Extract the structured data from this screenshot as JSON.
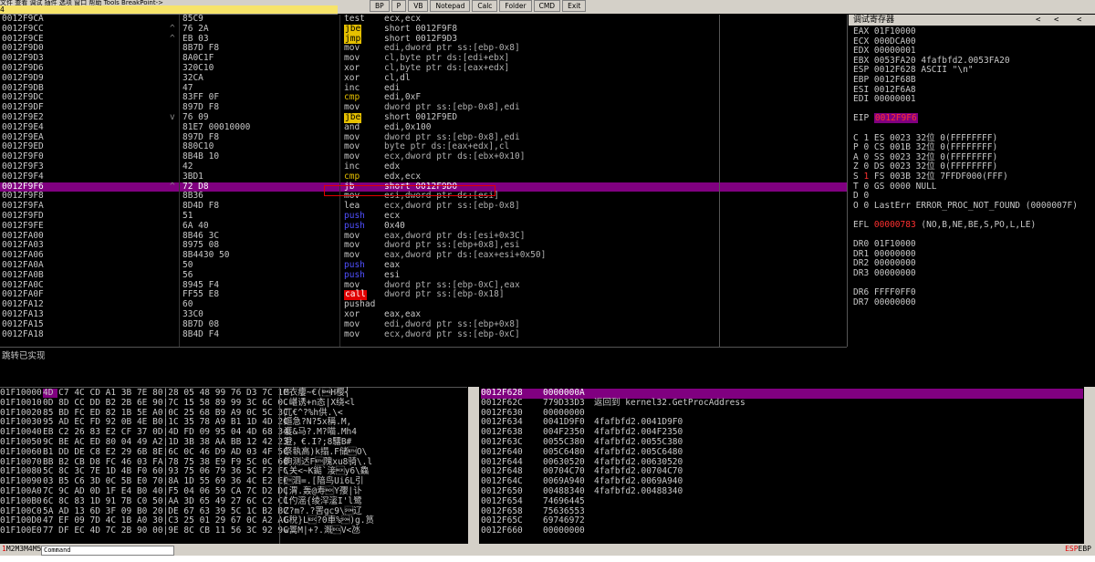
{
  "topbar": {
    "menu_text": "文件 查看 调试 插件 选项 窗口 帮助  Tools  BreakPoint->",
    "addr_field": "4",
    "buttons": [
      "BP",
      "P",
      "VB",
      "Notepad",
      "Calc",
      "Folder",
      "CMD",
      "Exit"
    ]
  },
  "disasm": {
    "rows": [
      {
        "addr": "0012F9CA",
        "mark": "",
        "hex": "85C9",
        "mn": "test",
        "op": "ecx,ecx",
        "mnStyle": "",
        "opStyle": "",
        "sel": false
      },
      {
        "addr": "0012F9CC",
        "mark": "^",
        "hex": "76 2A",
        "mn": "jbe",
        "op": "short 0012F9F8",
        "mnStyle": "jmp",
        "opStyle": "",
        "sel": false
      },
      {
        "addr": "0012F9CE",
        "mark": "^",
        "hex": "EB 03",
        "mn": "jmp",
        "op": "short 0012F9D3",
        "mnStyle": "jmp",
        "opStyle": "",
        "sel": false
      },
      {
        "addr": "0012F9D0",
        "mark": "",
        "hex": "8B7D F8",
        "mn": "mov",
        "op": "edi,dword ptr ss:[ebp-0x8]",
        "mnStyle": "",
        "opStyle": "mem",
        "sel": false
      },
      {
        "addr": "0012F9D3",
        "mark": "",
        "hex": "8A0C1F",
        "mn": "mov",
        "op": "cl,byte ptr ds:[edi+ebx]",
        "mnStyle": "",
        "opStyle": "mem",
        "sel": false
      },
      {
        "addr": "0012F9D6",
        "mark": "",
        "hex": "320C10",
        "mn": "xor",
        "op": "cl,byte ptr ds:[eax+edx]",
        "mnStyle": "",
        "opStyle": "mem",
        "sel": false
      },
      {
        "addr": "0012F9D9",
        "mark": "",
        "hex": "32CA",
        "mn": "xor",
        "op": "cl,dl",
        "mnStyle": "",
        "opStyle": "",
        "sel": false
      },
      {
        "addr": "0012F9DB",
        "mark": "",
        "hex": "47",
        "mn": "inc",
        "op": "edi",
        "mnStyle": "",
        "opStyle": "",
        "sel": false
      },
      {
        "addr": "0012F9DC",
        "mark": "",
        "hex": "83FF 0F",
        "mn": "cmp",
        "op": "edi,0xF",
        "mnStyle": "cmp",
        "opStyle": "",
        "sel": false
      },
      {
        "addr": "0012F9DF",
        "mark": "",
        "hex": "897D F8",
        "mn": "mov",
        "op": "dword ptr ss:[ebp-0x8],edi",
        "mnStyle": "",
        "opStyle": "mem",
        "sel": false
      },
      {
        "addr": "0012F9E2",
        "mark": "v",
        "hex": "76 09",
        "mn": "jbe",
        "op": "short 0012F9ED",
        "mnStyle": "jmp",
        "opStyle": "",
        "sel": false
      },
      {
        "addr": "0012F9E4",
        "mark": "",
        "hex": "81E7 00010000",
        "mn": "and",
        "op": "edi,0x100",
        "mnStyle": "",
        "opStyle": "",
        "sel": false
      },
      {
        "addr": "0012F9EA",
        "mark": "",
        "hex": "897D F8",
        "mn": "mov",
        "op": "dword ptr ss:[ebp-0x8],edi",
        "mnStyle": "",
        "opStyle": "mem",
        "sel": false
      },
      {
        "addr": "0012F9ED",
        "mark": "",
        "hex": "880C10",
        "mn": "mov",
        "op": "byte ptr ds:[eax+edx],cl",
        "mnStyle": "",
        "opStyle": "mem",
        "sel": false
      },
      {
        "addr": "0012F9F0",
        "mark": "",
        "hex": "8B4B 10",
        "mn": "mov",
        "op": "ecx,dword ptr ds:[ebx+0x10]",
        "mnStyle": "",
        "opStyle": "mem",
        "sel": false
      },
      {
        "addr": "0012F9F3",
        "mark": "",
        "hex": "42",
        "mn": "inc",
        "op": "edx",
        "mnStyle": "",
        "opStyle": "",
        "sel": false
      },
      {
        "addr": "0012F9F4",
        "mark": "",
        "hex": "3BD1",
        "mn": "cmp",
        "op": "edx,ecx",
        "mnStyle": "cmp",
        "opStyle": "",
        "sel": false
      },
      {
        "addr": "0012F9F6",
        "mark": "^",
        "hex": "72 D8",
        "mn": "jb",
        "op": "short 0012F9D0",
        "mnStyle": "jmp",
        "opStyle": "",
        "sel": true
      },
      {
        "addr": "0012F9F8",
        "mark": "",
        "hex": "8B36",
        "mn": "mov",
        "op": "esi,dword ptr ds:[esi]",
        "mnStyle": "",
        "opStyle": "mem",
        "sel": false
      },
      {
        "addr": "0012F9FA",
        "mark": "",
        "hex": "8D4D F8",
        "mn": "lea",
        "op": "ecx,dword ptr ss:[ebp-0x8]",
        "mnStyle": "",
        "opStyle": "mem",
        "sel": false
      },
      {
        "addr": "0012F9FD",
        "mark": "",
        "hex": "51",
        "mn": "push",
        "op": "ecx",
        "mnStyle": "push",
        "opStyle": "",
        "sel": false
      },
      {
        "addr": "0012F9FE",
        "mark": "",
        "hex": "6A 40",
        "mn": "push",
        "op": "0x40",
        "mnStyle": "push",
        "opStyle": "imm",
        "sel": false
      },
      {
        "addr": "0012FA00",
        "mark": "",
        "hex": "8B46 3C",
        "mn": "mov",
        "op": "eax,dword ptr ds:[esi+0x3C]",
        "mnStyle": "",
        "opStyle": "mem",
        "sel": false
      },
      {
        "addr": "0012FA03",
        "mark": "",
        "hex": "8975 08",
        "mn": "mov",
        "op": "dword ptr ss:[ebp+0x8],esi",
        "mnStyle": "",
        "opStyle": "mem",
        "sel": false
      },
      {
        "addr": "0012FA06",
        "mark": "",
        "hex": "8B4430 50",
        "mn": "mov",
        "op": "eax,dword ptr ds:[eax+esi+0x50]",
        "mnStyle": "",
        "opStyle": "mem",
        "sel": false
      },
      {
        "addr": "0012FA0A",
        "mark": "",
        "hex": "50",
        "mn": "push",
        "op": "eax",
        "mnStyle": "push",
        "opStyle": "",
        "sel": false
      },
      {
        "addr": "0012FA0B",
        "mark": "",
        "hex": "56",
        "mn": "push",
        "op": "esi",
        "mnStyle": "push",
        "opStyle": "",
        "sel": false
      },
      {
        "addr": "0012FA0C",
        "mark": "",
        "hex": "8945 F4",
        "mn": "mov",
        "op": "dword ptr ss:[ebp-0xC],eax",
        "mnStyle": "",
        "opStyle": "mem",
        "sel": false
      },
      {
        "addr": "0012FA0F",
        "mark": "",
        "hex": "FF55 E8",
        "mn": "call",
        "op": "dword ptr ss:[ebp-0x18]",
        "mnStyle": "call",
        "opStyle": "mem",
        "sel": false
      },
      {
        "addr": "0012FA12",
        "mark": "",
        "hex": "60",
        "mn": "pushad",
        "op": "",
        "mnStyle": "",
        "opStyle": "",
        "sel": false
      },
      {
        "addr": "0012FA13",
        "mark": "",
        "hex": "33C0",
        "mn": "xor",
        "op": "eax,eax",
        "mnStyle": "",
        "opStyle": "",
        "sel": false
      },
      {
        "addr": "0012FA15",
        "mark": "",
        "hex": "8B7D 08",
        "mn": "mov",
        "op": "edi,dword ptr ss:[ebp+0x8]",
        "mnStyle": "",
        "opStyle": "mem",
        "sel": false
      },
      {
        "addr": "0012FA18",
        "mark": "",
        "hex": "8B4D F4",
        "mn": "mov",
        "op": "ecx,dword ptr ss:[ebp-0xC]",
        "mnStyle": "",
        "opStyle": "mem",
        "sel": false
      }
    ]
  },
  "info": {
    "text": "跳转已实现"
  },
  "registers": {
    "title": "调试寄存器",
    "lines": [
      {
        "t": "EAX 01F10000",
        "s": ""
      },
      {
        "t": "ECX 000DCA00",
        "s": ""
      },
      {
        "t": "EDX 00000001",
        "s": ""
      },
      {
        "t": "EBX 0053FA20  4fafbfd2.0053FA20",
        "s": ""
      },
      {
        "t": "ESP 0012F628  ASCII \"\\n\"",
        "s": ""
      },
      {
        "t": "EBP 0012F68B",
        "s": ""
      },
      {
        "t": "ESI 0012F6A8",
        "s": ""
      },
      {
        "t": "EDI 00000001",
        "s": ""
      },
      {
        "t": "",
        "s": ""
      },
      {
        "t": "EIP",
        "s": "",
        "hl": "0012F9F6"
      },
      {
        "t": "",
        "s": ""
      },
      {
        "t": "C 1  ES 0023 32位 0(FFFFFFFF)",
        "s": ""
      },
      {
        "t": "P 0  CS 001B 32位 0(FFFFFFFF)",
        "s": ""
      },
      {
        "t": "A 0  SS 0023 32位 0(FFFFFFFF)",
        "s": ""
      },
      {
        "t": "Z 0  DS 0023 32位 0(FFFFFFFF)",
        "s": ""
      },
      {
        "t": "S 1  FS 003B 32位 7FFDF000(FFF)",
        "s": "sflag"
      },
      {
        "t": "T 0  GS 0000 NULL",
        "s": ""
      },
      {
        "t": "D 0",
        "s": ""
      },
      {
        "t": "O 0  LastErr ERROR_PROC_NOT_FOUND (0000007F)",
        "s": ""
      },
      {
        "t": "",
        "s": ""
      },
      {
        "t": "EFL",
        "s": "efl",
        "red": "00000783",
        "rest": " (NO,B,NE,BE,S,PO,L,LE)"
      },
      {
        "t": "",
        "s": ""
      },
      {
        "t": "DR0 01F10000",
        "s": ""
      },
      {
        "t": "DR1 00000000",
        "s": ""
      },
      {
        "t": "DR2 00000000",
        "s": ""
      },
      {
        "t": "DR3 00000000",
        "s": ""
      },
      {
        "t": "",
        "s": ""
      },
      {
        "t": "DR6 FFFF0FF0",
        "s": ""
      },
      {
        "t": "DR7 00000000",
        "s": ""
      }
    ]
  },
  "dump": {
    "rows": [
      {
        "a": "01F10000",
        "h": "4D C7 4C CD A1 3B 7E 80|28 05 48 99 76 D3 7C 1C",
        "s": "M衣瘻~€(\u0005H樱⎨"
      },
      {
        "a": "01F10010",
        "h": "0D 8D CC DD B2 2B 6E 90|7C 15 58 89 99 3C 6C 0C",
        "s": ".嵁诱+n态|X绕<l"
      },
      {
        "a": "01F10020",
        "h": "85 BD FC ED 82 1B 5E A0|0C 25 68 B9 A9 0C 5C 3C",
        "s": "兀€^?%h供.\\<"
      },
      {
        "a": "01F10030",
        "h": "95 AD EC FD 92 0B 4E B0|1C 35 78 A9 B1 1D 4D 2C",
        "s": "嫗急?N?5x稱.M,"
      },
      {
        "a": "01F10040",
        "h": "EB C2 26 83 E2 CF 37 0D|4D FD 09 95 04 4D 68 34",
        "s": "濩&马?.M?喵.Mh4"
      },
      {
        "a": "01F10050",
        "h": "9C BE AC ED 80 04 49 A2|1D 3B 38 AA BB 12 42 23",
        "s": "澄，€.I?;8驑B#"
      },
      {
        "a": "01F10060",
        "h": "B1 DD DE C8 E2 29 6B 8E|6C 0C 46 D9 AD 03 4F 5C",
        "s": "祭執高)k搨.F储\u0003O\\"
      },
      {
        "a": "01F10070",
        "h": "BB B2 CB D8 FC 46 03 FA|78 75 38 E9 F9 5C 0C 6C",
        "s": "齁测迖F\u0003隗xu8骑\\.l"
      },
      {
        "a": "01F10080",
        "h": "5C 8C 3C 7E 1D 4B F0 60|93 75 06 79 36 5C F2 FC",
        "s": "\\关<~K鐑`淁\u0006y6\\鱻"
      },
      {
        "a": "01F10090",
        "h": "03 B5 C6 3D 0C 5B E0 70|8A 1D 55 69 36 4C E2 EC",
        "s": "\u0003泗=.[隌鸟Ui6L引"
      },
      {
        "a": "01F100A0",
        "h": "7C 9C AD 0D 1F E4 B0 40|F5 04 06 59 CA 7C D2 DC",
        "s": "|渭.轰@寿\u0006Y孾|讣"
      },
      {
        "a": "01F100B0",
        "h": "6C 8C 83 1D 91 7B C0 50|AA 3D 65 49 27 6C C2 CC",
        "s": "l仢滛{绫浫㵥I'l鹭"
      },
      {
        "a": "01F100C0",
        "h": "5A AD 13 6D 3F 09 B0 20|DE 67 63 39 5C 1C B2 BC",
        "s": "Z?m?.?罟gc9\\\u0001辽"
      },
      {
        "a": "01F100D0",
        "h": "47 EF 09 7D 4C 1B A0 30|C3 25 01 29 67 0C A2 AC",
        "s": "G稅}L\u001b?0車%\u0001)g.筼"
      },
      {
        "a": "01F100E0",
        "h": "77 DF EC 4D 7C 2B 90 00|9E 8C CB 11 56 3C 92 9C",
        "s": "w暠M|+?.溉\u0011V<氹"
      }
    ]
  },
  "stack": {
    "rows": [
      {
        "a": "0012F628",
        "v": "0000000A",
        "c": "",
        "sel": true
      },
      {
        "a": "0012F62C",
        "v": "779D33D3",
        "c": "返回到 kernel32.GetProcAddress",
        "sel": false
      },
      {
        "a": "0012F630",
        "v": "00000000",
        "c": "",
        "sel": false
      },
      {
        "a": "0012F634",
        "v": "0041D9F0",
        "c": "4fafbfd2.0041D9F0",
        "sel": false
      },
      {
        "a": "0012F638",
        "v": "004F2350",
        "c": "4fafbfd2.004F2350",
        "sel": false
      },
      {
        "a": "0012F63C",
        "v": "0055C380",
        "c": "4fafbfd2.0055C380",
        "sel": false
      },
      {
        "a": "0012F640",
        "v": "005C6480",
        "c": "4fafbfd2.005C6480",
        "sel": false
      },
      {
        "a": "0012F644",
        "v": "00630520",
        "c": "4fafbfd2.00630520",
        "sel": false
      },
      {
        "a": "0012F648",
        "v": "00704C70",
        "c": "4fafbfd2.00704C70",
        "sel": false
      },
      {
        "a": "0012F64C",
        "v": "0069A940",
        "c": "4fafbfd2.0069A940",
        "sel": false
      },
      {
        "a": "0012F650",
        "v": "00488340",
        "c": "4fafbfd2.00488340",
        "sel": false
      },
      {
        "a": "0012F654",
        "v": "74696445",
        "c": "",
        "sel": false
      },
      {
        "a": "0012F658",
        "v": "75636553",
        "c": "",
        "sel": false
      },
      {
        "a": "0012F65C",
        "v": "69746972",
        "c": "",
        "sel": false
      },
      {
        "a": "0012F660",
        "v": "00000000",
        "c": "",
        "sel": false
      }
    ]
  },
  "command": {
    "label_red": "1",
    "label": "M2M3M4M5",
    "input": "Command",
    "status_red": "ESP",
    "status": "EBP"
  }
}
